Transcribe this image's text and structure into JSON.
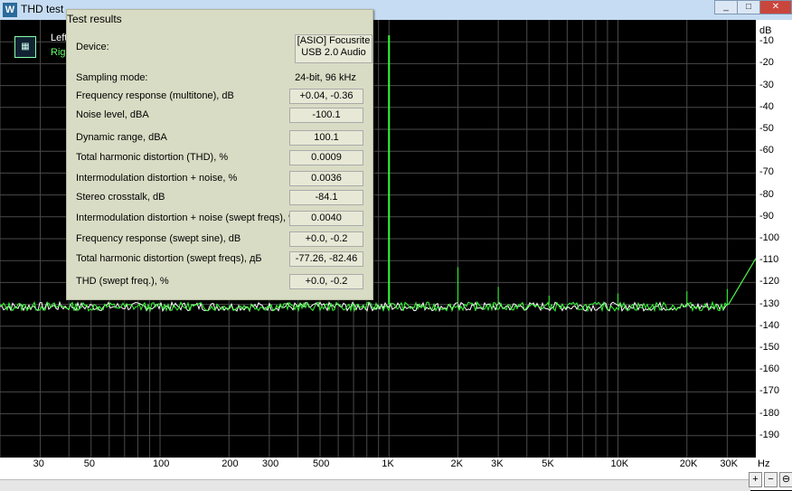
{
  "window": {
    "title": "THD test",
    "icon": "waveform-icon",
    "minimize": "_",
    "maximize": "□",
    "close": "✕"
  },
  "legend": {
    "left_label": "Left",
    "right_label": "Right",
    "icon": "grid-icon"
  },
  "test_results": {
    "title": "Test results",
    "rows": [
      {
        "label": "Device:",
        "value": "[ASIO] Focusrite USB 2.0 Audio",
        "value_line1": "[ASIO] Focusrite",
        "value_line2": "USB 2.0 Audio"
      },
      {
        "label": "Sampling mode:",
        "value": "24-bit, 96 kHz"
      },
      {
        "label": "Frequency response (multitone), dB",
        "value": "+0.04, -0.36"
      },
      {
        "label": "Noise level, dBA",
        "value": "-100.1"
      },
      {
        "label": "Dynamic range, dBA",
        "value": "100.1"
      },
      {
        "label": "Total harmonic distortion (THD), %",
        "value": "0.0009"
      },
      {
        "label": "Intermodulation distortion + noise, %",
        "value": "0.0036"
      },
      {
        "label": "Stereo crosstalk, dB",
        "value": "-84.1"
      },
      {
        "label": "Intermodulation distortion + noise (swept freqs), %",
        "value": "0.0040"
      },
      {
        "label": "Frequency response (swept sine), dB",
        "value": "+0.0, -0.2"
      },
      {
        "label": "Total harmonic distortion (swept freqs), дБ",
        "value": "-77.26, -82.46"
      },
      {
        "label": "THD (swept freq.), %",
        "value": "+0.0, -0.2"
      }
    ]
  },
  "y_axis": {
    "unit": "dB",
    "ticks": [
      "-10",
      "-20",
      "-30",
      "-40",
      "-50",
      "-60",
      "-70",
      "-80",
      "-90",
      "-100",
      "-110",
      "-120",
      "-130",
      "-140",
      "-150",
      "-160",
      "-170",
      "-180",
      "-190"
    ]
  },
  "x_axis": {
    "unit": "Hz",
    "ticks": [
      "30",
      "50",
      "100",
      "200",
      "300",
      "500",
      "1K",
      "2K",
      "3K",
      "5K",
      "10K",
      "20K",
      "30K"
    ]
  },
  "zoom_controls": [
    "zoom-in-icon",
    "zoom-out-icon",
    "zoom-fit-icon"
  ],
  "colors": {
    "left": "#ffffff",
    "right": "#33ff33",
    "grid": "#4a4a4a",
    "panel": "#d9dcc4"
  }
}
